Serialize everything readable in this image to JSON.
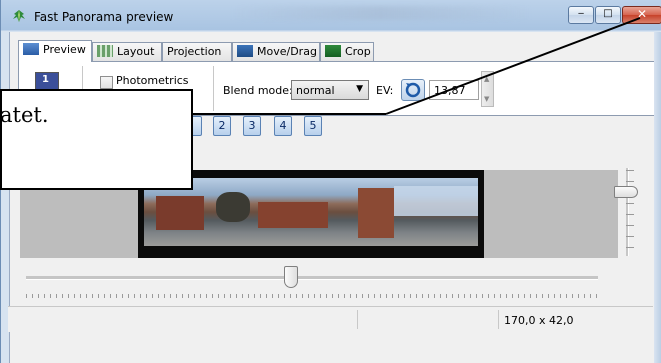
{
  "window": {
    "title": "Fast Panorama preview",
    "controls": [
      "minimize",
      "maximize",
      "close"
    ]
  },
  "tabs": [
    {
      "label": "Preview",
      "icon": "gl-preview-icon",
      "active": true
    },
    {
      "label": "Layout",
      "icon": "layout-icon",
      "active": false
    },
    {
      "label": "Projection",
      "icon": "",
      "active": false
    },
    {
      "label": "Move/Drag",
      "icon": "move-drag-icon",
      "active": false
    },
    {
      "label": "Crop",
      "icon": "crop-icon",
      "active": false
    }
  ],
  "toolbar": {
    "image_button_label": "1",
    "photometrics_label": "Photometrics",
    "photometrics_checked": false,
    "blend_mode_label": "Blend mode:",
    "blend_mode_value": "normal",
    "ev_label": "EV:",
    "ev_value": "13,87"
  },
  "image_buttons": [
    "2",
    "3",
    "4",
    "5"
  ],
  "annotation": {
    "text": "atet."
  },
  "status": {
    "dimensions": "170,0 x 42,0"
  }
}
